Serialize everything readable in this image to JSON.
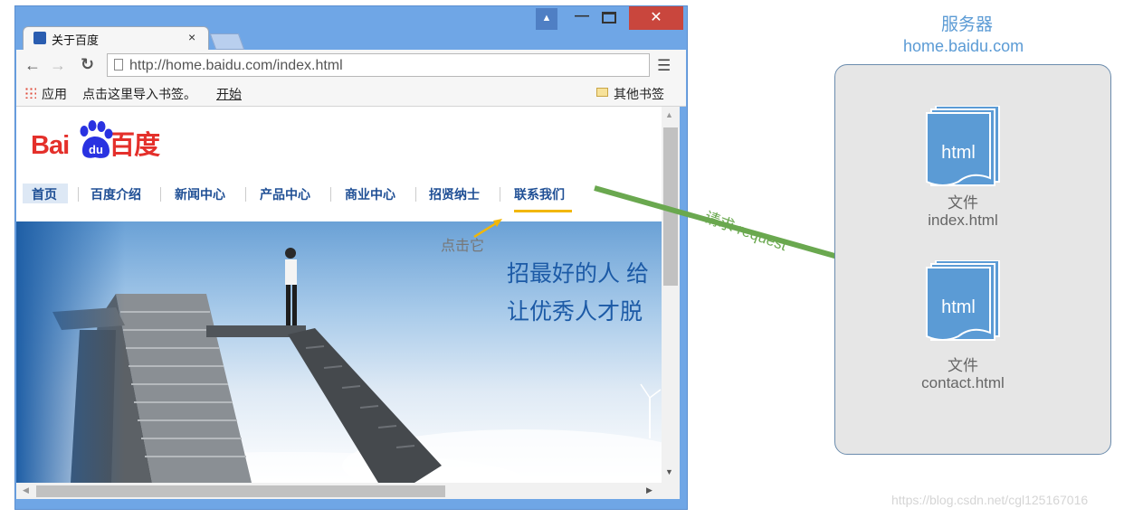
{
  "browser": {
    "tab_title": "关于百度",
    "tab_close": "×",
    "win_close": "✕",
    "url": "http://home.baidu.com/index.html",
    "bookmarks": {
      "apps": "应用",
      "import": "点击这里导入书签。",
      "start": "开始",
      "other": "其他书签"
    }
  },
  "baidu_page": {
    "logo_left": "Bai",
    "logo_paw": "du",
    "logo_right": "百度",
    "nav": [
      "首页",
      "百度介绍",
      "新闻中心",
      "产品中心",
      "商业中心",
      "招贤纳士",
      "联系我们"
    ],
    "banner_line1": "招最好的人  给",
    "banner_line2": "让优秀人才脱"
  },
  "annotation": {
    "click_hint": "点击它",
    "request_label": "请求 request"
  },
  "server": {
    "title": "服务器",
    "host": "home.baidu.com",
    "files": [
      {
        "icon_text": "html",
        "type_label": "文件",
        "name": "index.html"
      },
      {
        "icon_text": "html",
        "type_label": "文件",
        "name": "contact.html"
      }
    ]
  },
  "watermark": "https://blog.csdn.net/cgl125167016",
  "colors": {
    "window_frame": "#6fa6e6",
    "close_button": "#c9463d",
    "baidu_red": "#e4302b",
    "baidu_blue": "#2932e1",
    "nav_text": "#1f4f95",
    "hint_underline": "#f2b705",
    "arrow_green": "#6aa84f",
    "server_accent": "#5b9bd5",
    "doc_icon": "#5b9bd5",
    "server_box": "#e6e6e6"
  }
}
